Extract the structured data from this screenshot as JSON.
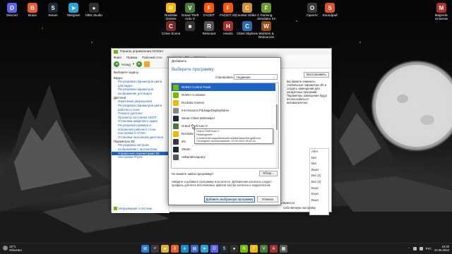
{
  "desktop_icons_left": [
    {
      "label": "Discord",
      "color": "#5865f2",
      "glyph": "D"
    },
    {
      "label": "Brave",
      "color": "#f05a28",
      "glyph": "B"
    },
    {
      "label": "Steam",
      "color": "#1b2838",
      "glyph": "S"
    },
    {
      "label": "Telegram",
      "color": "#2aa1da",
      "glyph": "➤"
    },
    {
      "label": "OBS Studio",
      "color": "#303030",
      "glyph": "●"
    }
  ],
  "desktop_icons_top": [
    {
      "label": "Rockstar Games",
      "color": "#f7b500",
      "glyph": "R"
    },
    {
      "label": "Grand Theft Auto V",
      "color": "#4a7a3a",
      "glyph": "V"
    },
    {
      "label": "FACEIT",
      "color": "#ff5500",
      "glyph": "F"
    },
    {
      "label": "FACEIT AC",
      "color": "#ff5500",
      "glyph": "F"
    },
    {
      "label": "Counter-Strike 2",
      "color": "#d0902a",
      "glyph": "C"
    },
    {
      "label": "Farming Simulator 22",
      "color": "#6a9a2a",
      "glyph": "F"
    }
  ],
  "desktop_icons_row2": [
    {
      "label": "Crime Scene",
      "color": "#7a2a2a",
      "glyph": "C"
    },
    {
      "label": "",
      "color": "#333",
      "glyph": "■"
    },
    {
      "label": "Remnant",
      "color": "#555",
      "glyph": "R"
    },
    {
      "label": "Hearts",
      "color": "#a03030",
      "glyph": "H"
    },
    {
      "label": "Cities Skylines",
      "color": "#2a6ab0",
      "glyph": "C"
    },
    {
      "label": "Workers & Resources",
      "color": "#9a4a1a",
      "glyph": "W"
    }
  ],
  "desktop_icons_right": [
    {
      "label": "OpenIV",
      "color": "#3a3a3a",
      "glyph": "O"
    },
    {
      "label": "Soundpad",
      "color": "#e0502a",
      "glyph": "S"
    },
    {
      "label": "Magnetic Universe",
      "color": "#b03030",
      "glyph": "M"
    }
  ],
  "nvidia": {
    "title": "Панель управления NVIDIA",
    "menu": [
      "Файл",
      "Правка",
      "Рабочий стол",
      "Параметры 3D",
      "Справка"
    ],
    "back_label": "Назад",
    "select_task": "Выберите задачу...",
    "groups": [
      {
        "name": "Видео",
        "items": [
          "Регулировка параметров цвета для видео",
          "Регулировка параметров изображения для видео"
        ]
      },
      {
        "name": "Дисплей",
        "items": [
          "Изменение разрешения",
          "Регулировка параметров цвета рабочего стола",
          "Поворот дисплея",
          "Просмотр состояния HDCP",
          "Установка цифрового аудио",
          "Регулировка размера и положения рабочего стола",
          "Настройка G-SYNC",
          "Установка нескольких дисплеев"
        ]
      },
      {
        "name": "Параметры 3D",
        "items": [
          "Регулировка настроек изображения с просмотром",
          "Управление параметрами 3D",
          "Настройка PhysX"
        ]
      }
    ],
    "selected_item": "Управление параметрами 3D",
    "footer_link": "Информация о системе",
    "restore_label": "Восстановить",
    "description": "Вы можете изменить глобальные параметры 3D и создать замещения для конкретных программ. Параметры замещения будут использоваться автоматически.",
    "right_list": [
      "Авто",
      "Вкл",
      "Вкл",
      "Выкл",
      "Вкл (2)",
      "Вкл (2)",
      "Выкл",
      "Выкл",
      "Выкл"
    ],
    "bottom_text_1": "... , чтобы вывести",
    "bottom_text_2": "собственную настройку"
  },
  "dialog": {
    "title": "Добавить",
    "header": "Выберите программу:",
    "sort_label": "Сортировать по:",
    "sort_value": "Недавние",
    "programs": [
      {
        "name": "NVIDIA Control Panel",
        "color": "#76b900",
        "selected": true
      },
      {
        "name": "NVIDIA Container",
        "color": "#76b900",
        "selected": false
      },
      {
        "name": "Rockstar Games",
        "color": "#f7b500",
        "selected": false
      },
      {
        "name": "ms-resource:PackageDisplayName",
        "color": "#888888",
        "selected": false
      },
      {
        "name": "Steam Client WebHelper",
        "color": "#1b2838",
        "selected": false
      },
      {
        "name": "Grand Theft Auto V",
        "color": "#4a7a3a",
        "selected": false
      },
      {
        "name": "Rockstar Ga...",
        "color": "#f7b500",
        "selected": false
      },
      {
        "name": "afs",
        "color": "#3a3a3a",
        "selected": false
      },
      {
        "name": "Steam",
        "color": "#1b2838",
        "selected": false
      },
      {
        "name": "railsandinvaquery",
        "color": "#555555",
        "selected": false
      }
    ],
    "tooltip_lines": [
      "Grand Theft Auto V",
      "Размещение: c:\\users\\user\\appdata\\local\\rockstar\\launcher\\gta5.exe",
      "Последнее использование: 20.06.2024 18:40:41"
    ],
    "cant_find": "Не можете найти программу?",
    "browse_label": "Обзор...",
    "help_text": "Найдите и добавьте программу или каталог. Добавление каталога создаст профиль для всех исполняемых файлов внутри каталога и подкаталогов.",
    "ok_label": "Добавить выбранную программу",
    "cancel_label": "Отмена"
  },
  "taskbar": {
    "temperature": "15°C",
    "condition": "Облачно",
    "apps": [
      {
        "name": "start-icon",
        "color": "#2a7ad8",
        "glyph": "⊞"
      },
      {
        "name": "search-icon",
        "color": "#3a3a3a",
        "glyph": "⌕"
      },
      {
        "name": "files-icon",
        "color": "#e0b030",
        "glyph": "▰"
      },
      {
        "name": "brave-icon",
        "color": "#f05a28",
        "glyph": "B"
      },
      {
        "name": "edge-icon",
        "color": "#1a8ad0",
        "glyph": "e"
      },
      {
        "name": "store-icon",
        "color": "#3a6ad0",
        "glyph": "▤"
      },
      {
        "name": "telegram-icon",
        "color": "#2aa1da",
        "glyph": "➤"
      },
      {
        "name": "discord-icon",
        "color": "#5865f2",
        "glyph": "D"
      },
      {
        "name": "steam-icon",
        "color": "#1b2838",
        "glyph": "S"
      },
      {
        "name": "obs-icon",
        "color": "#303030",
        "glyph": "●"
      },
      {
        "name": "nvidia-icon",
        "color": "#76b900",
        "glyph": "N"
      },
      {
        "name": "rockstar-icon",
        "color": "#f7b500",
        "glyph": "R"
      },
      {
        "name": "gta-icon",
        "color": "#4a7a3a",
        "glyph": "V"
      },
      {
        "name": "app-icon",
        "color": "#a03030",
        "glyph": "A"
      },
      {
        "name": "app2-icon",
        "color": "#5a5a5a",
        "glyph": "▦"
      }
    ],
    "lang": "РУС",
    "time": "18:30",
    "date": "20.06.2024"
  }
}
